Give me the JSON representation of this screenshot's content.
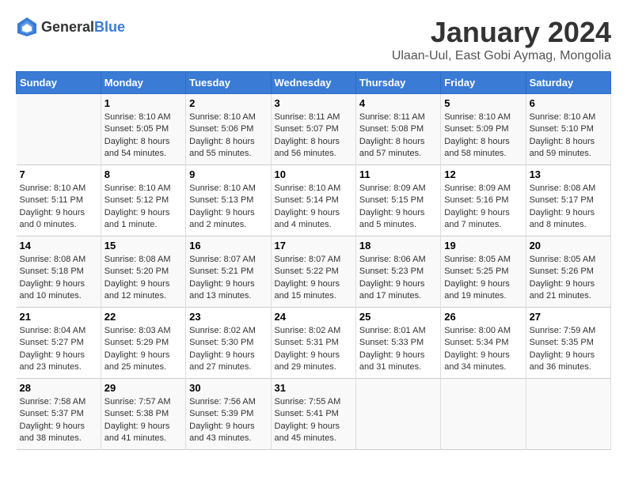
{
  "logo": {
    "general": "General",
    "blue": "Blue"
  },
  "title": "January 2024",
  "subtitle": "Ulaan-Uul, East Gobi Aymag, Mongolia",
  "days_header": [
    "Sunday",
    "Monday",
    "Tuesday",
    "Wednesday",
    "Thursday",
    "Friday",
    "Saturday"
  ],
  "weeks": [
    [
      {
        "day": "",
        "info": ""
      },
      {
        "day": "1",
        "info": "Sunrise: 8:10 AM\nSunset: 5:05 PM\nDaylight: 8 hours\nand 54 minutes."
      },
      {
        "day": "2",
        "info": "Sunrise: 8:10 AM\nSunset: 5:06 PM\nDaylight: 8 hours\nand 55 minutes."
      },
      {
        "day": "3",
        "info": "Sunrise: 8:11 AM\nSunset: 5:07 PM\nDaylight: 8 hours\nand 56 minutes."
      },
      {
        "day": "4",
        "info": "Sunrise: 8:11 AM\nSunset: 5:08 PM\nDaylight: 8 hours\nand 57 minutes."
      },
      {
        "day": "5",
        "info": "Sunrise: 8:10 AM\nSunset: 5:09 PM\nDaylight: 8 hours\nand 58 minutes."
      },
      {
        "day": "6",
        "info": "Sunrise: 8:10 AM\nSunset: 5:10 PM\nDaylight: 8 hours\nand 59 minutes."
      }
    ],
    [
      {
        "day": "7",
        "info": "Sunrise: 8:10 AM\nSunset: 5:11 PM\nDaylight: 9 hours\nand 0 minutes."
      },
      {
        "day": "8",
        "info": "Sunrise: 8:10 AM\nSunset: 5:12 PM\nDaylight: 9 hours\nand 1 minute."
      },
      {
        "day": "9",
        "info": "Sunrise: 8:10 AM\nSunset: 5:13 PM\nDaylight: 9 hours\nand 2 minutes."
      },
      {
        "day": "10",
        "info": "Sunrise: 8:10 AM\nSunset: 5:14 PM\nDaylight: 9 hours\nand 4 minutes."
      },
      {
        "day": "11",
        "info": "Sunrise: 8:09 AM\nSunset: 5:15 PM\nDaylight: 9 hours\nand 5 minutes."
      },
      {
        "day": "12",
        "info": "Sunrise: 8:09 AM\nSunset: 5:16 PM\nDaylight: 9 hours\nand 7 minutes."
      },
      {
        "day": "13",
        "info": "Sunrise: 8:08 AM\nSunset: 5:17 PM\nDaylight: 9 hours\nand 8 minutes."
      }
    ],
    [
      {
        "day": "14",
        "info": "Sunrise: 8:08 AM\nSunset: 5:18 PM\nDaylight: 9 hours\nand 10 minutes."
      },
      {
        "day": "15",
        "info": "Sunrise: 8:08 AM\nSunset: 5:20 PM\nDaylight: 9 hours\nand 12 minutes."
      },
      {
        "day": "16",
        "info": "Sunrise: 8:07 AM\nSunset: 5:21 PM\nDaylight: 9 hours\nand 13 minutes."
      },
      {
        "day": "17",
        "info": "Sunrise: 8:07 AM\nSunset: 5:22 PM\nDaylight: 9 hours\nand 15 minutes."
      },
      {
        "day": "18",
        "info": "Sunrise: 8:06 AM\nSunset: 5:23 PM\nDaylight: 9 hours\nand 17 minutes."
      },
      {
        "day": "19",
        "info": "Sunrise: 8:05 AM\nSunset: 5:25 PM\nDaylight: 9 hours\nand 19 minutes."
      },
      {
        "day": "20",
        "info": "Sunrise: 8:05 AM\nSunset: 5:26 PM\nDaylight: 9 hours\nand 21 minutes."
      }
    ],
    [
      {
        "day": "21",
        "info": "Sunrise: 8:04 AM\nSunset: 5:27 PM\nDaylight: 9 hours\nand 23 minutes."
      },
      {
        "day": "22",
        "info": "Sunrise: 8:03 AM\nSunset: 5:29 PM\nDaylight: 9 hours\nand 25 minutes."
      },
      {
        "day": "23",
        "info": "Sunrise: 8:02 AM\nSunset: 5:30 PM\nDaylight: 9 hours\nand 27 minutes."
      },
      {
        "day": "24",
        "info": "Sunrise: 8:02 AM\nSunset: 5:31 PM\nDaylight: 9 hours\nand 29 minutes."
      },
      {
        "day": "25",
        "info": "Sunrise: 8:01 AM\nSunset: 5:33 PM\nDaylight: 9 hours\nand 31 minutes."
      },
      {
        "day": "26",
        "info": "Sunrise: 8:00 AM\nSunset: 5:34 PM\nDaylight: 9 hours\nand 34 minutes."
      },
      {
        "day": "27",
        "info": "Sunrise: 7:59 AM\nSunset: 5:35 PM\nDaylight: 9 hours\nand 36 minutes."
      }
    ],
    [
      {
        "day": "28",
        "info": "Sunrise: 7:58 AM\nSunset: 5:37 PM\nDaylight: 9 hours\nand 38 minutes."
      },
      {
        "day": "29",
        "info": "Sunrise: 7:57 AM\nSunset: 5:38 PM\nDaylight: 9 hours\nand 41 minutes."
      },
      {
        "day": "30",
        "info": "Sunrise: 7:56 AM\nSunset: 5:39 PM\nDaylight: 9 hours\nand 43 minutes."
      },
      {
        "day": "31",
        "info": "Sunrise: 7:55 AM\nSunset: 5:41 PM\nDaylight: 9 hours\nand 45 minutes."
      },
      {
        "day": "",
        "info": ""
      },
      {
        "day": "",
        "info": ""
      },
      {
        "day": "",
        "info": ""
      }
    ]
  ]
}
